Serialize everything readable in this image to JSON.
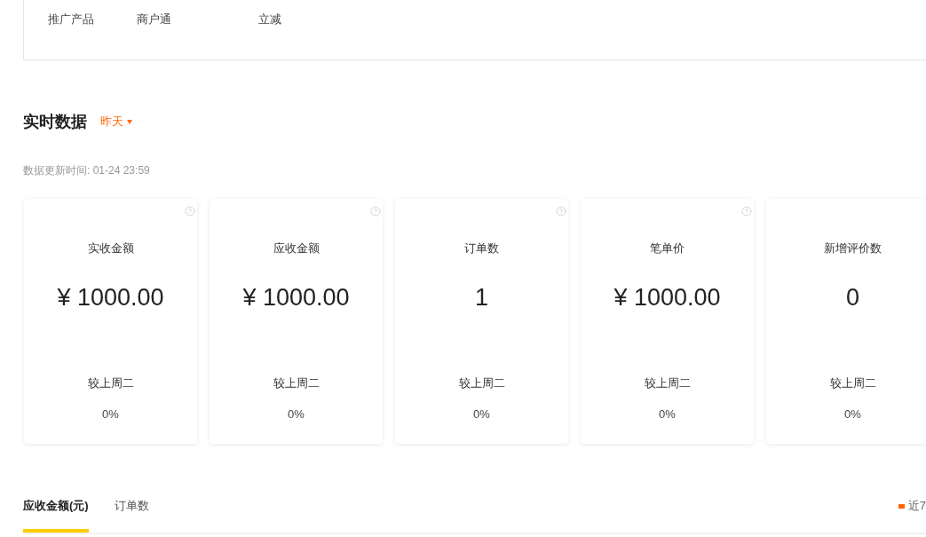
{
  "promo_table": {
    "cells": [
      "推广产品",
      "商户通",
      "立减"
    ]
  },
  "realtime": {
    "title": "实时数据",
    "period": {
      "label": "昨天"
    },
    "updated": "数据更新时间: 01-24 23:59",
    "metrics": [
      {
        "label": "实收金额",
        "value": "¥ 1000.00",
        "compare_label": "较上周二",
        "change": "0%",
        "help": true
      },
      {
        "label": "应收金额",
        "value": "¥ 1000.00",
        "compare_label": "较上周二",
        "change": "0%",
        "help": true
      },
      {
        "label": "订单数",
        "value": "1",
        "compare_label": "较上周二",
        "change": "0%",
        "help": true
      },
      {
        "label": "笔单价",
        "value": "¥ 1000.00",
        "compare_label": "较上周二",
        "change": "0%",
        "help": true
      },
      {
        "label": "新增评价数",
        "value": "0",
        "compare_label": "较上周二",
        "change": "0%",
        "help": false
      }
    ]
  },
  "trend": {
    "tabs": [
      {
        "label": "应收金额(元)",
        "selected": true
      },
      {
        "label": "订单数",
        "selected": false
      }
    ],
    "legend": [
      {
        "label": "近7",
        "color": "#ff6600"
      }
    ]
  }
}
